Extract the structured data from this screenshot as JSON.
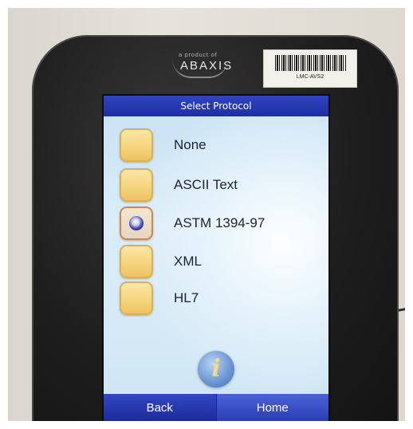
{
  "device": {
    "brand_tagline": "a product of",
    "brand_name": "ABAXIS",
    "asset_label": "LMC-AVS2"
  },
  "screen": {
    "title": "Select Protocol",
    "options": [
      {
        "label": "None",
        "selected": false
      },
      {
        "label": "ASCII Text",
        "selected": false
      },
      {
        "label": "ASTM 1394-97",
        "selected": true
      },
      {
        "label": "XML",
        "selected": false
      },
      {
        "label": "HL7",
        "selected": false
      }
    ],
    "info_glyph": "i",
    "nav": {
      "back_label": "Back",
      "home_label": "Home"
    }
  },
  "icons": [
    "info-icon",
    "radio-selected-icon",
    "barcode-icon"
  ],
  "colors": {
    "titlebar": "#1f2fa3",
    "checkbox": "#f5d37a",
    "screen_bg": "#d9ecf8"
  }
}
